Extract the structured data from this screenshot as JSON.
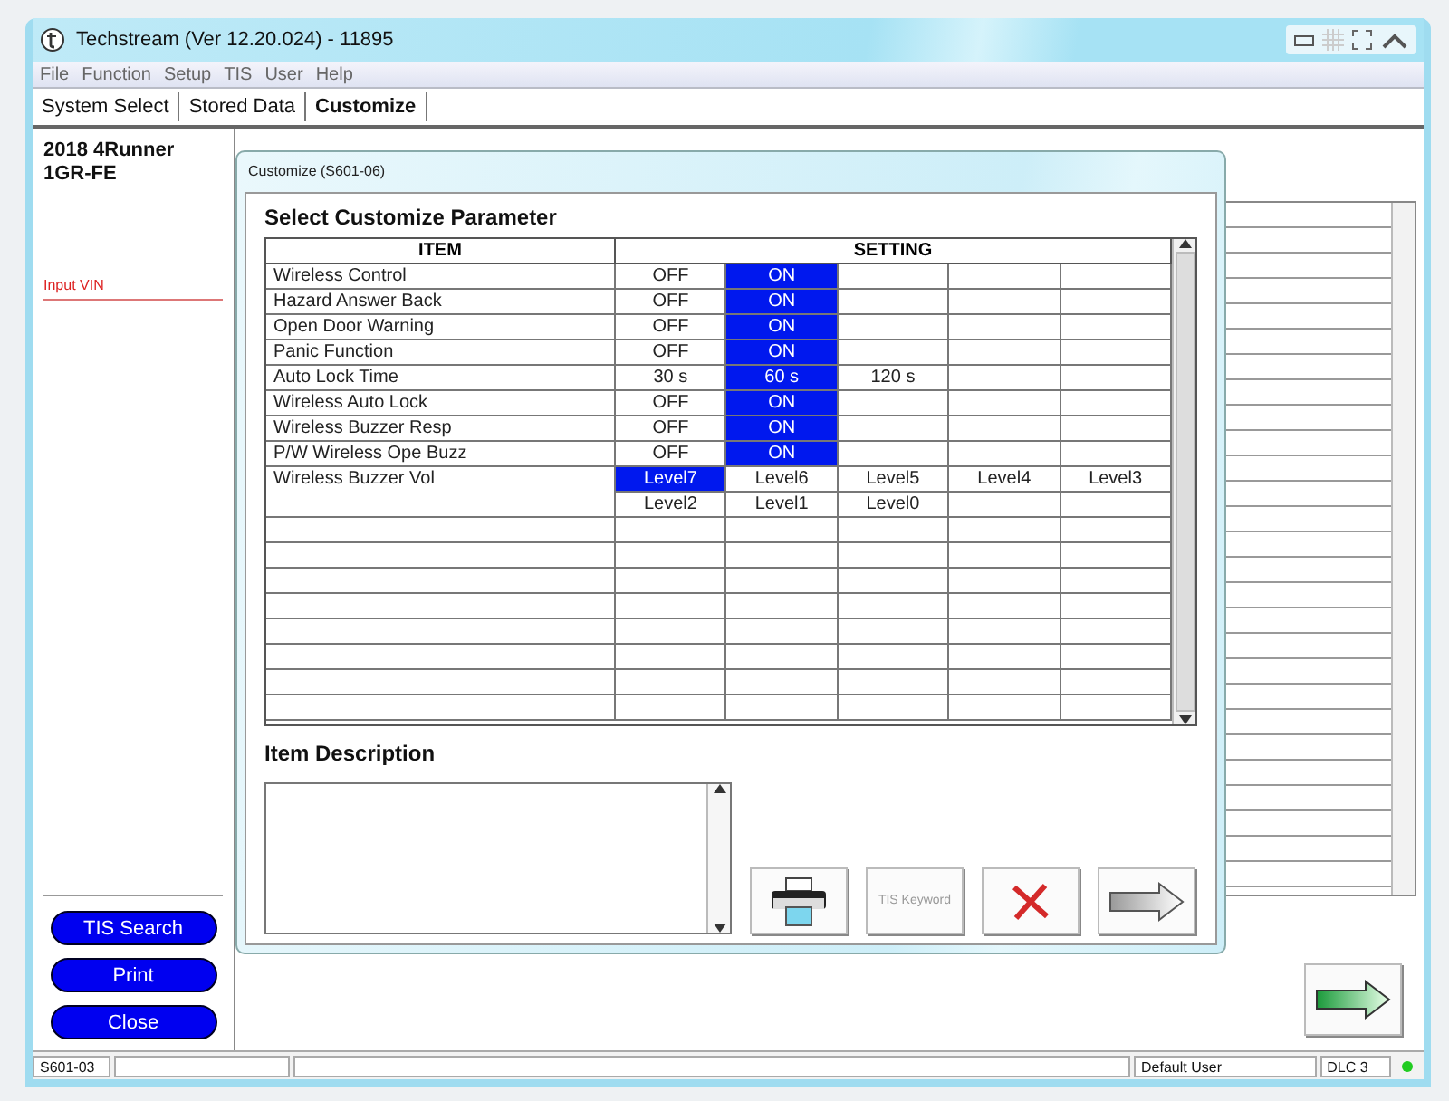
{
  "window": {
    "title": "Techstream (Ver 12.20.024) - 11895"
  },
  "menu": [
    "File",
    "Function",
    "Setup",
    "TIS",
    "User",
    "Help"
  ],
  "tabs": [
    {
      "label": "System Select",
      "selected": false
    },
    {
      "label": "Stored Data",
      "selected": false
    },
    {
      "label": "Customize",
      "selected": true
    }
  ],
  "sidebar": {
    "vehicle": [
      "2018 4Runner",
      "1GR-FE"
    ],
    "input_vin": "Input VIN",
    "buttons": [
      "TIS Search",
      "Print",
      "Close"
    ]
  },
  "dialog": {
    "title": "Customize (S601-06)",
    "heading": "Select Customize Parameter",
    "columns": [
      "ITEM",
      "SETTING"
    ],
    "rows": [
      {
        "item": "Wireless Control",
        "options": [
          {
            "label": "OFF",
            "selected": false
          },
          {
            "label": "ON",
            "selected": true
          }
        ]
      },
      {
        "item": "Hazard Answer Back",
        "options": [
          {
            "label": "OFF",
            "selected": false
          },
          {
            "label": "ON",
            "selected": true
          }
        ]
      },
      {
        "item": "Open Door Warning",
        "options": [
          {
            "label": "OFF",
            "selected": false
          },
          {
            "label": "ON",
            "selected": true
          }
        ]
      },
      {
        "item": "Panic Function",
        "options": [
          {
            "label": "OFF",
            "selected": false
          },
          {
            "label": "ON",
            "selected": true
          }
        ]
      },
      {
        "item": "Auto Lock Time",
        "options": [
          {
            "label": "30 s",
            "selected": false
          },
          {
            "label": "60 s",
            "selected": true
          },
          {
            "label": "120 s",
            "selected": false
          }
        ]
      },
      {
        "item": "Wireless Auto Lock",
        "options": [
          {
            "label": "OFF",
            "selected": false
          },
          {
            "label": "ON",
            "selected": true
          }
        ]
      },
      {
        "item": "Wireless Buzzer Resp",
        "options": [
          {
            "label": "OFF",
            "selected": false
          },
          {
            "label": "ON",
            "selected": true
          }
        ]
      },
      {
        "item": "P/W Wireless Ope Buzz",
        "options": [
          {
            "label": "OFF",
            "selected": false
          },
          {
            "label": "ON",
            "selected": true
          }
        ]
      },
      {
        "item": "Wireless Buzzer Vol",
        "options": [
          {
            "label": "Level7",
            "selected": true
          },
          {
            "label": "Level6",
            "selected": false
          },
          {
            "label": "Level5",
            "selected": false
          },
          {
            "label": "Level4",
            "selected": false
          },
          {
            "label": "Level3",
            "selected": false
          },
          {
            "label": "Level2",
            "selected": false
          },
          {
            "label": "Level1",
            "selected": false
          },
          {
            "label": "Level0",
            "selected": false
          }
        ]
      }
    ],
    "description_heading": "Item Description",
    "buttons": [
      {
        "kind": "print",
        "disabled": false
      },
      {
        "kind": "keyword",
        "label": "TIS Keyword",
        "disabled": true
      },
      {
        "kind": "cancel",
        "disabled": false
      },
      {
        "kind": "next",
        "disabled": false
      }
    ]
  },
  "status_bar": {
    "code": "S601-03",
    "user": "Default User",
    "link": "DLC 3",
    "connected": true
  }
}
